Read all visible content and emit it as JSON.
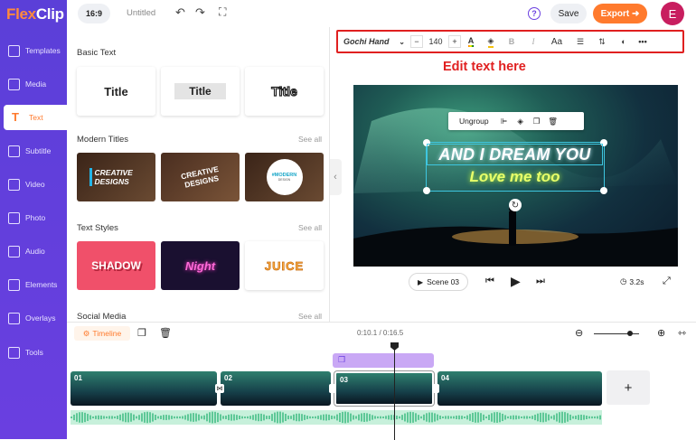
{
  "app": {
    "logo_flex": "Flex",
    "logo_clip": "Clip",
    "ratio": "16:9",
    "title": "Untitled",
    "help": "?",
    "save_label": "Save",
    "export_label": "Export",
    "avatar_letter": "E"
  },
  "sidebar": {
    "items": [
      {
        "label": "Templates",
        "icon": "templates-icon"
      },
      {
        "label": "Media",
        "icon": "media-icon"
      },
      {
        "label": "Text",
        "icon": "text-icon",
        "active": true
      },
      {
        "label": "Subtitle",
        "icon": "subtitle-icon"
      },
      {
        "label": "Video",
        "icon": "video-icon"
      },
      {
        "label": "Photo",
        "icon": "photo-icon"
      },
      {
        "label": "Audio",
        "icon": "audio-icon"
      },
      {
        "label": "Elements",
        "icon": "elements-icon"
      },
      {
        "label": "Overlays",
        "icon": "overlays-icon"
      },
      {
        "label": "Tools",
        "icon": "tools-icon"
      }
    ]
  },
  "library": {
    "basic_text": "Basic Text",
    "basic_tiles": [
      "Title",
      "Title",
      "Title"
    ],
    "modern_titles": "Modern Titles",
    "see_all": "See all",
    "modern_tiles": [
      "CREATIVE DESIGNS",
      "CREATIVE DESIGNS",
      "#MODERN"
    ],
    "modern_small": "DESIGN",
    "text_styles": "Text Styles",
    "style_tiles": [
      "SHADOW",
      "Night",
      "JUICE"
    ],
    "social_media": "Social Media"
  },
  "toolbar": {
    "font": "Gochi Hand",
    "minus": "−",
    "size": "140",
    "plus": "+",
    "case": "Aa"
  },
  "annotation": "Edit text here",
  "canvas": {
    "ungroup": "Ungroup",
    "line1": "AND I DREAM YOU",
    "line2": "Love me too"
  },
  "player": {
    "scene": "Scene 03",
    "duration": "3.2s"
  },
  "timeline": {
    "label": "Timeline",
    "time": "0:10.1 / 0:16.5",
    "zoom_level": 0.8,
    "clips": [
      {
        "num": "01"
      },
      {
        "num": "02"
      },
      {
        "num": "03"
      },
      {
        "num": "04"
      }
    ],
    "add": "+"
  },
  "colors": {
    "accent": "#ff7a2d",
    "sidebar": "#5b3fd8",
    "annotation": "#e02020",
    "text_fill": "#e8ff6a",
    "selection": "#3ec6e0"
  }
}
